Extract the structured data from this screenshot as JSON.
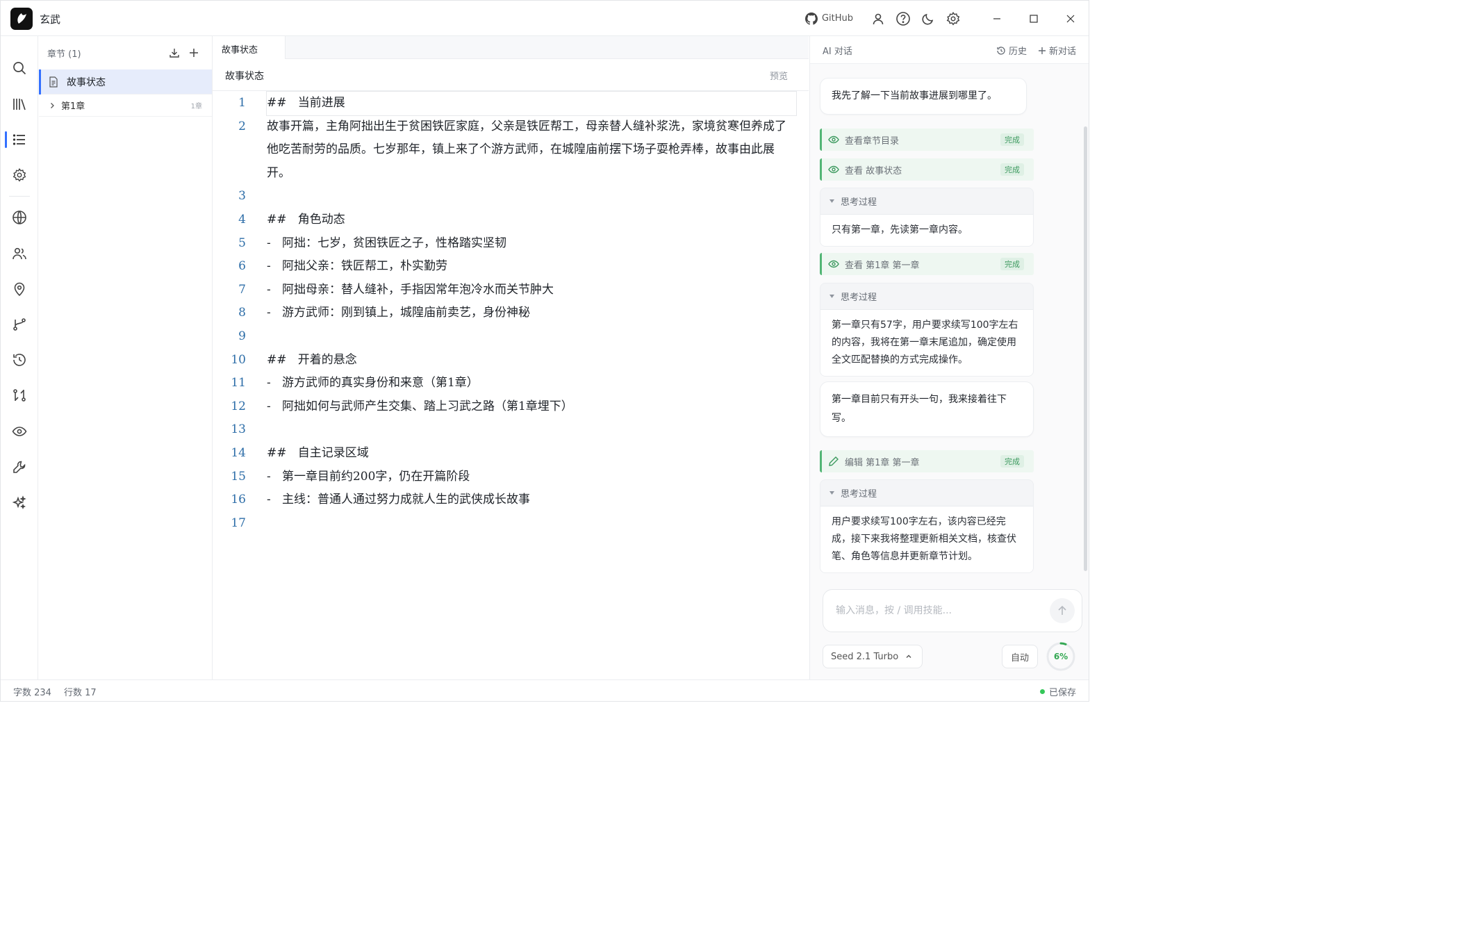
{
  "app": {
    "title": "玄武"
  },
  "titlebar": {
    "github_label": "GitHub"
  },
  "chapters": {
    "header": "章节 (1)",
    "items": [
      {
        "label": "故事状态"
      },
      {
        "label": "第1章",
        "badge": "1章"
      }
    ]
  },
  "editor": {
    "tab": "故事状态",
    "doc_title": "故事状态",
    "preview_label": "预览",
    "lines": [
      {
        "no": "1",
        "text": "##   当前进展"
      },
      {
        "no": "2",
        "text": "故事开篇，主角阿拙出生于贫困铁匠家庭，父亲是铁匠帮工，母亲替人缝补浆洗，家境贫寒但养成了他吃苦耐劳的品质。七岁那年，镇上来了个游方武师，在城隍庙前摆下场子耍枪弄棒，故事由此展开。"
      },
      {
        "no": "3",
        "text": ""
      },
      {
        "no": "4",
        "text": "##   角色动态"
      },
      {
        "no": "5",
        "text": "-   阿拙：七岁，贫困铁匠之子，性格踏实坚韧"
      },
      {
        "no": "6",
        "text": "-   阿拙父亲：铁匠帮工，朴实勤劳"
      },
      {
        "no": "7",
        "text": "-   阿拙母亲：替人缝补，手指因常年泡冷水而关节肿大"
      },
      {
        "no": "8",
        "text": "-   游方武师：刚到镇上，城隍庙前卖艺，身份神秘"
      },
      {
        "no": "9",
        "text": ""
      },
      {
        "no": "10",
        "text": "##   开着的悬念"
      },
      {
        "no": "11",
        "text": "-   游方武师的真实身份和来意（第1章）"
      },
      {
        "no": "12",
        "text": "-   阿拙如何与武师产生交集、踏上习武之路（第1章埋下）"
      },
      {
        "no": "13",
        "text": ""
      },
      {
        "no": "14",
        "text": "##   自主记录区域"
      },
      {
        "no": "15",
        "text": "-   第一章目前约200字，仍在开篇阶段"
      },
      {
        "no": "16",
        "text": "-   主线：普通人通过努力成就人生的武侠成长故事"
      },
      {
        "no": "17",
        "text": ""
      }
    ]
  },
  "status": {
    "word_count": "字数 234",
    "line_count": "行数 17",
    "saved": "已保存"
  },
  "ai": {
    "title": "AI 对话",
    "history_label": "历史",
    "new_chat_label": "新对话",
    "messages": {
      "m1": "我先了解一下当前故事进展到哪里了。",
      "t1": "查看章节目录",
      "t2": "查看 故事状态",
      "k1": "只有第一章，先读第一章内容。",
      "t3": "查看 第1章 第一章",
      "k2": "第一章只有57字，用户要求续写100字左右的内容，我将在第一章末尾追加，确定使用全文匹配替换的方式完成操作。",
      "m2": "第一章目前只有开头一句，我来接着往下写。",
      "t4": "编辑 第1章 第一章",
      "k3": "用户要求续写100字左右，该内容已经完成，接下来我将整理更新相关文档，核查伏笔、角色等信息并更新章节计划。"
    },
    "done_label": "完成",
    "think_label": "思考过程",
    "input_placeholder": "输入消息，按 / 调用技能...",
    "model": "Seed 2.1 Turbo",
    "auto_label": "自动",
    "usage_pct": 6,
    "usage_label": "6%",
    "accent": "#34a853"
  }
}
